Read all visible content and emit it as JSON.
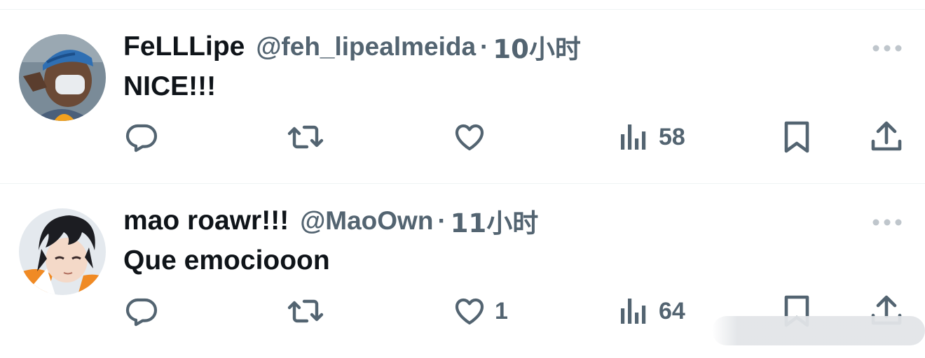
{
  "tweets": [
    {
      "name": "FeLLLipe",
      "handle": "@feh_lipealmeida",
      "separator": "·",
      "time": "10小时",
      "text": "NICE!!!",
      "likes": "",
      "views": "58",
      "avatar_icon": "avatar-masked-person",
      "avatar_colors": {
        "bg": "#7a8b98",
        "bandana": "#2f6fb3",
        "mask": "#e9ecef",
        "skin": "#6b4a36"
      }
    },
    {
      "name": "mao roawr!!!",
      "handle": "@MaoOwn",
      "separator": "·",
      "time": "11小时",
      "text": "Que emociooon",
      "likes": "1",
      "views": "64",
      "avatar_icon": "avatar-anime-character",
      "avatar_colors": {
        "bg": "#e4e9ee",
        "hair": "#1c1d22",
        "skin": "#f4d9c8",
        "jacket": "#f08a24"
      }
    }
  ],
  "colors": {
    "text": "#0f1419",
    "secondary": "#536471",
    "divider": "#eff3f4"
  },
  "icons": [
    "reply-icon",
    "retweet-icon",
    "like-icon",
    "views-icon",
    "bookmark-icon",
    "share-icon",
    "more-icon"
  ]
}
